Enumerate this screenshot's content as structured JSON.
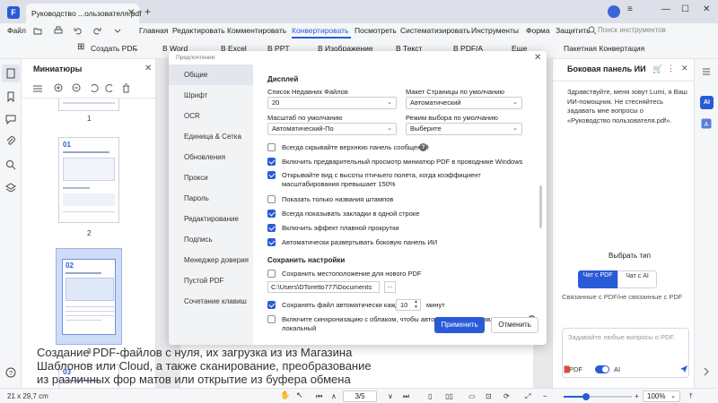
{
  "app": {
    "document_tab": "Руководство ...ользователя.pdf",
    "colors": {
      "accent": "#2a5bd7",
      "brand": "#2a5bd7"
    }
  },
  "menu": {
    "file": "Файл",
    "items": [
      "Главная",
      "Редактировать",
      "Комментировать",
      "Конвертировать",
      "Посмотреть",
      "Систематизировать",
      "Инструменты",
      "Форма",
      "Защитить"
    ],
    "active": "Конвертировать",
    "search_placeholder": "Поиск инструментов"
  },
  "toolbar": {
    "create_pdf": "Создать PDF",
    "items": [
      "В Word",
      "В Excel",
      "В PPT",
      "В Изображение",
      "В Текст",
      "В PDF/A",
      "Еще"
    ],
    "batch": "Пакетная Конвертация"
  },
  "thumbnails": {
    "title": "Миниатюры",
    "pages": [
      "1",
      "2",
      "3"
    ],
    "selected_page": "3",
    "page2_heading": "01",
    "page3_heading": "02",
    "page4_heading": "03"
  },
  "document": {
    "visible_text": "Создание PDF-файлов с нуля, их загрузка из из Магазина Шаблонов или Cloud, а также сканирование, преобразование из различных фор матов или открытие из буфера обмена"
  },
  "dialog": {
    "title": "Предпочтения",
    "nav": [
      "Общие",
      "Шрифт",
      "OCR",
      "Единица & Сетка",
      "Обновления",
      "Прокси",
      "Пароль",
      "Редактирование",
      "Подпись",
      "Менеджер доверия",
      "Пустой PDF",
      "Сочетание клавиш"
    ],
    "active_nav": "Общие",
    "display_section": "Дисплей",
    "recent_files_label": "Список Недавних Файлов",
    "recent_files_value": "20",
    "page_layout_label": "Макет Страницы по умолчанию",
    "page_layout_value": "Автоматический",
    "zoom_label": "Масштаб по умолчанию",
    "zoom_value": "Автоматический-По",
    "select_mode_label": "Режим выбора по умолчанию",
    "select_mode_value": "Выберите",
    "checkboxes": [
      {
        "label": "Всегда скрывайте верхнюю панель сообщений",
        "checked": false,
        "help": true
      },
      {
        "label": "Включить предварительный просмотр миниатюр PDF в проводнике Windows",
        "checked": true
      },
      {
        "label": "Открывайте вид с высоты птичьего полета, когда коэффициент масштабирования превышает 150%",
        "checked": true
      },
      {
        "label": "Показать только названия штампов",
        "checked": false
      },
      {
        "label": "Всегда показывать закладки в одной строке",
        "checked": true
      },
      {
        "label": "Включить эффект плавной прокрутки",
        "checked": true
      },
      {
        "label": "Автоматически развертывать боковую панель ИИ",
        "checked": true
      }
    ],
    "save_section": "Сохранить настройки",
    "save_location_label": "Сохранить местоположение для нового PDF",
    "save_location_checked": false,
    "save_path": "C:\\Users\\DToretto777\\Documents",
    "browse_label": "...",
    "autosave_label": "Сохранять файл автоматически каждые",
    "autosave_checked": true,
    "autosave_value": "10",
    "autosave_unit": "минут",
    "cloud_sync_label": "Включите синхронизацию с облаком, чтобы автоматически отправлять локальный",
    "cloud_sync_checked": false,
    "apply_button": "Применить",
    "cancel_button": "Отменить"
  },
  "ai_panel": {
    "title": "Боковая панель ИИ",
    "greeting": "Здравствуйте, меня зовут Lumi, я Ваш ИИ-помощник. Не стесняйтесь задавать мне вопросы о «Руководство пользователя.pdf».",
    "pick_type": "Выбрать тип",
    "type_pdf": "Чат с PDF",
    "type_ai": "Чат с AI",
    "associated": "Связанные с PDF/не связанные с PDF",
    "input_placeholder": "Задавайте любые вопросы о PDF.",
    "mode_pdf": "PDF",
    "mode_ai": "AI",
    "rail_ai": "AI"
  },
  "status": {
    "page_size": "21 x 29,7 cm",
    "page_field": "3",
    "page_total": "/5",
    "zoom_value": "100%",
    "zoom_fraction": 0.33
  }
}
